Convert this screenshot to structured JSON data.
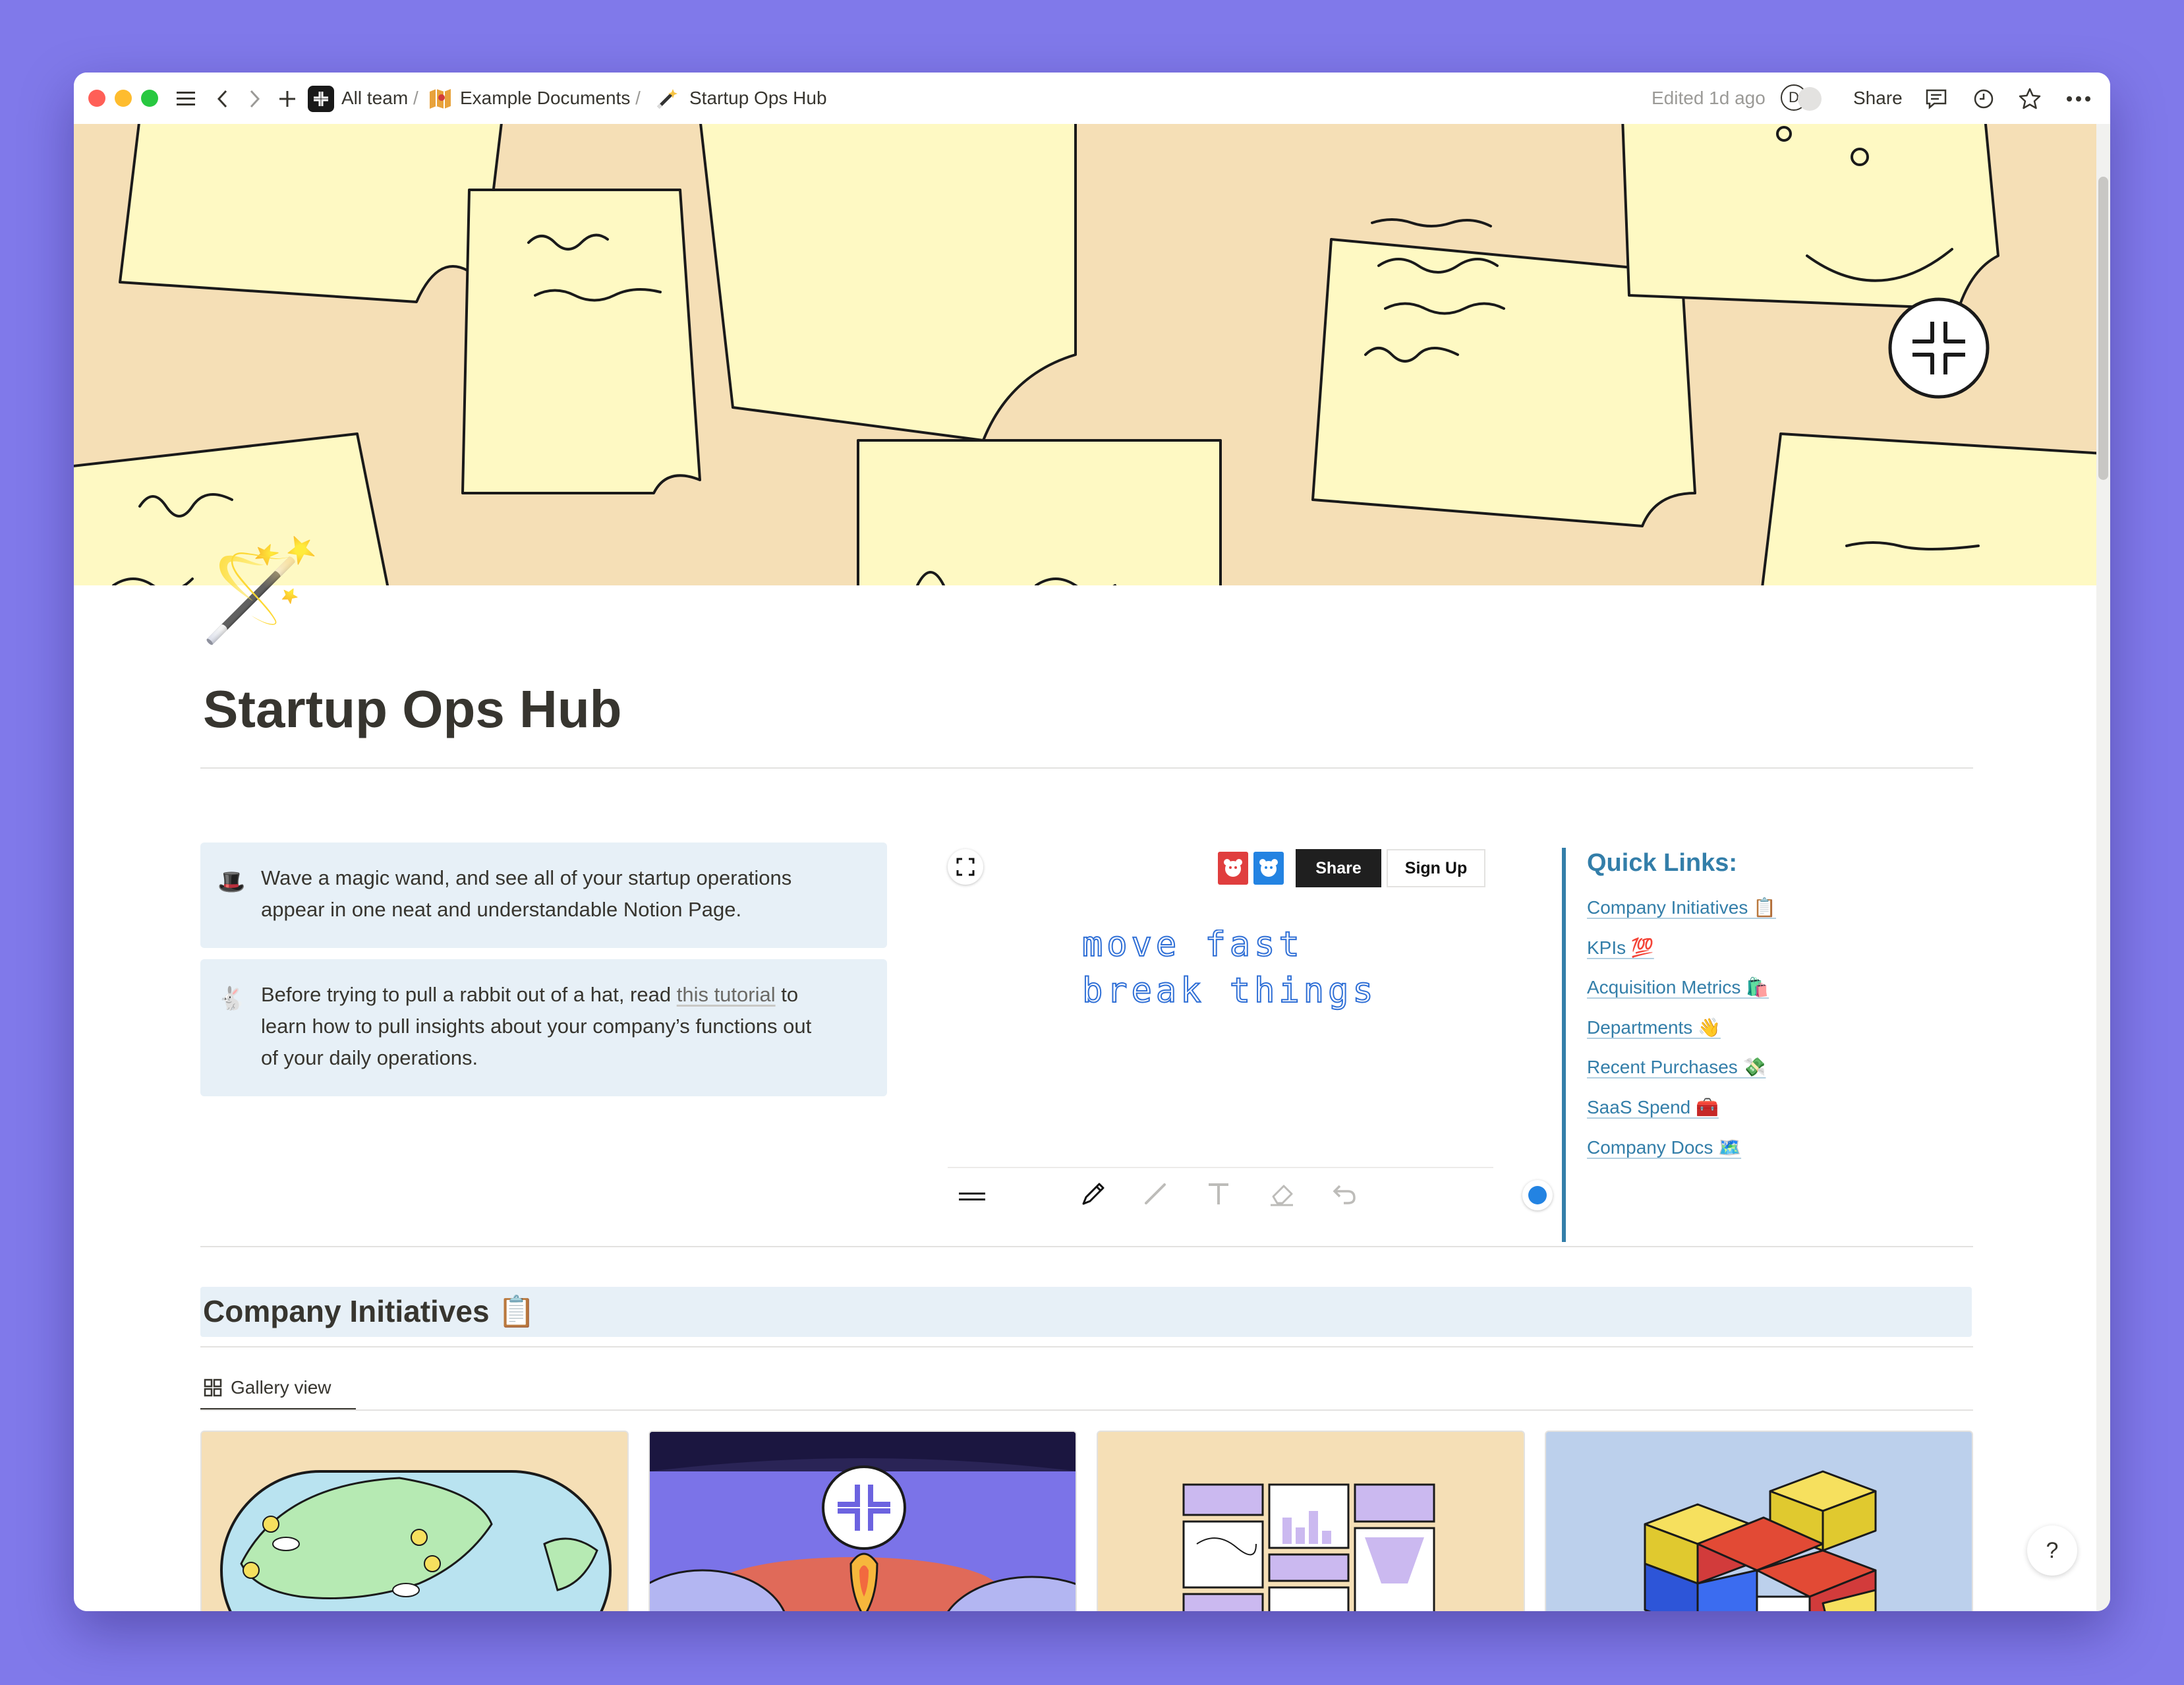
{
  "topbar": {
    "breadcrumbs": [
      {
        "label": "All team",
        "icon": "workspace-logo-icon"
      },
      {
        "label": "Example Documents",
        "icon": "map-emoji-icon"
      },
      {
        "label": "Startup Ops Hub",
        "icon": "magic-wand-icon"
      }
    ],
    "separator": "/",
    "edited": "Edited 1d ago",
    "avatar_initial": "D",
    "share_label": "Share"
  },
  "page": {
    "icon": "🪄",
    "title": "Startup Ops Hub"
  },
  "callouts": [
    {
      "emoji": "🎩",
      "lines": [
        "Wave a magic wand, and see all of your startup operations",
        "appear in one neat and understandable Notion Page."
      ]
    },
    {
      "emoji": "🐇",
      "line1_prefix": "Before trying to pull a rabbit out of a hat, read ",
      "link": "this tutorial",
      "line1_suffix": " to",
      "line2": "learn how to pull insights about your company’s functions out",
      "line3": "of your daily operations."
    }
  ],
  "whiteboard": {
    "share_label": "Share",
    "signup_label": "Sign Up",
    "handwriting": [
      "move fast",
      "break things"
    ],
    "ink_color": "#2f6fd6",
    "dot_color": "#2383e2"
  },
  "quick_links": {
    "title": "Quick Links:",
    "items": [
      "Company Initiatives 📋",
      "KPIs 💯",
      "Acquisition Metrics 🛍️",
      "Departments 👋",
      "Recent Purchases 💸",
      "SaaS Spend 🧰",
      "Company Docs 🗺️"
    ]
  },
  "section": {
    "title": "Company Initiatives 📋",
    "view_tab": "Gallery view"
  },
  "help_label": "?",
  "colors": {
    "background": "#8079ea",
    "cover": "#f5dfb6",
    "sticky": "#fef9c3",
    "callout": "#e7f0f7",
    "link": "#337ea9"
  }
}
